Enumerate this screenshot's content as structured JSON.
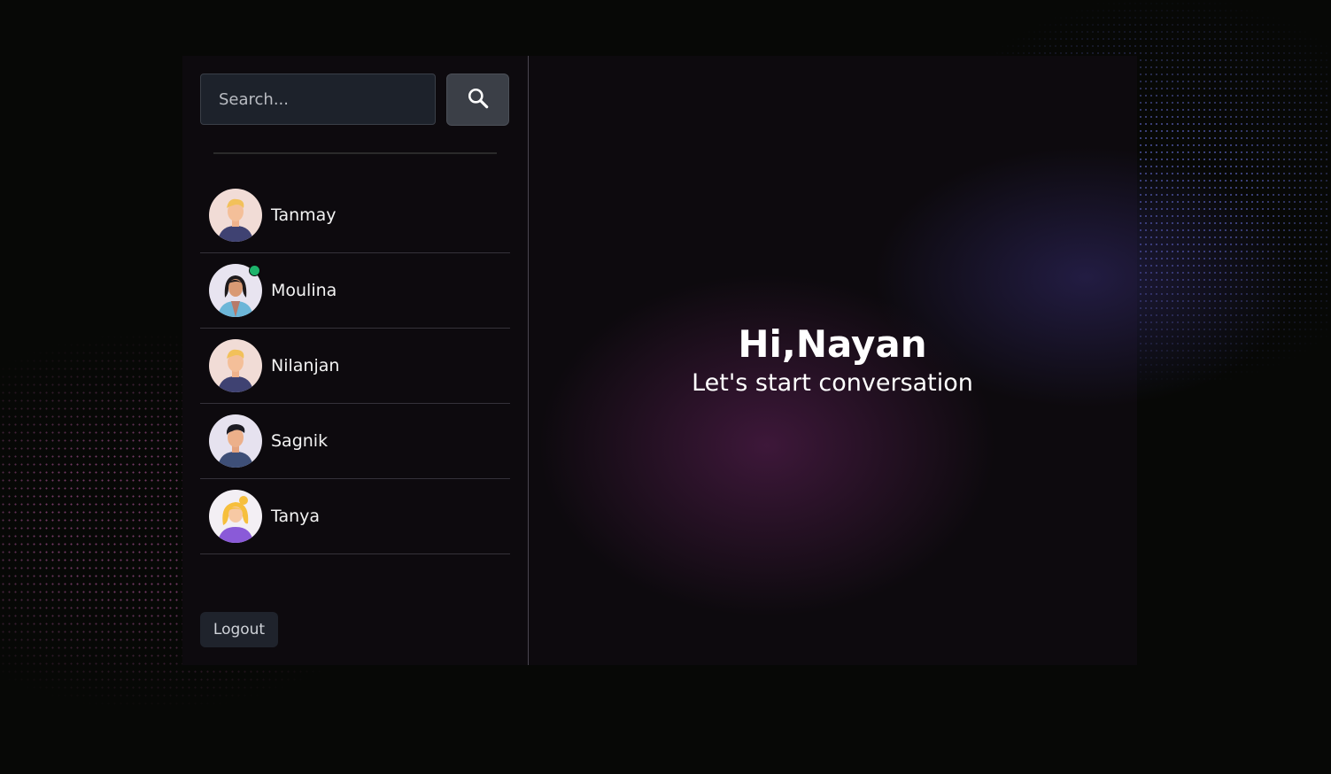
{
  "search": {
    "placeholder": "Search...",
    "button_icon": "search-icon"
  },
  "contacts": [
    {
      "name": "Tanmay",
      "online": false,
      "avatar": "avatar-man-blond"
    },
    {
      "name": "Moulina",
      "online": true,
      "avatar": "avatar-woman-dark-hair"
    },
    {
      "name": "Nilanjan",
      "online": false,
      "avatar": "avatar-man-blond"
    },
    {
      "name": "Sagnik",
      "online": false,
      "avatar": "avatar-man-dark-hair"
    },
    {
      "name": "Tanya",
      "online": false,
      "avatar": "avatar-woman-blonde"
    }
  ],
  "logout_label": "Logout",
  "greeting": {
    "title": "Hi,Nayan",
    "subtitle": "Let's start conversation"
  },
  "colors": {
    "online": "#1db36b",
    "panel": "#0d0a0e",
    "button": "#3b3f47"
  }
}
